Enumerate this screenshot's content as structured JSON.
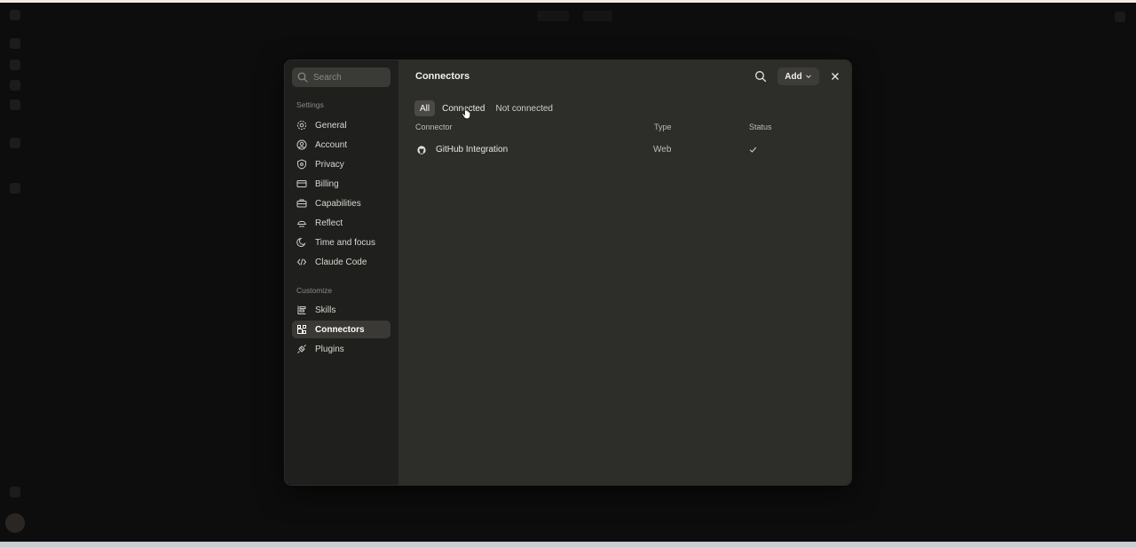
{
  "modal": {
    "search_placeholder": "Search",
    "settings_label": "Settings",
    "customize_label": "Customize",
    "settings_items": [
      {
        "label": "General",
        "icon": "gear-icon"
      },
      {
        "label": "Account",
        "icon": "user-circle-icon"
      },
      {
        "label": "Privacy",
        "icon": "shield-icon"
      },
      {
        "label": "Billing",
        "icon": "credit-card-icon"
      },
      {
        "label": "Capabilities",
        "icon": "briefcase-icon"
      },
      {
        "label": "Reflect",
        "icon": "reflect-icon"
      },
      {
        "label": "Time and focus",
        "icon": "moon-clock-icon"
      },
      {
        "label": "Claude Code",
        "icon": "code-icon"
      }
    ],
    "customize_items": [
      {
        "label": "Skills",
        "icon": "skills-icon"
      },
      {
        "label": "Connectors",
        "icon": "connectors-icon",
        "active": true
      },
      {
        "label": "Plugins",
        "icon": "plugin-icon"
      }
    ],
    "title": "Connectors",
    "add_label": "Add",
    "tabs": [
      "All",
      "Connected",
      "Not connected"
    ],
    "active_tab": "All",
    "columns": {
      "connector": "Connector",
      "type": "Type",
      "status": "Status"
    },
    "rows": [
      {
        "name": "GitHub Integration",
        "type": "Web",
        "status": "check-icon",
        "icon": "github-icon"
      }
    ]
  },
  "colors": {
    "backdrop": "#0d0d0d",
    "sidebar": "#1f1f1d",
    "main": "#2d2d2a",
    "active_item": "#3a3935"
  }
}
